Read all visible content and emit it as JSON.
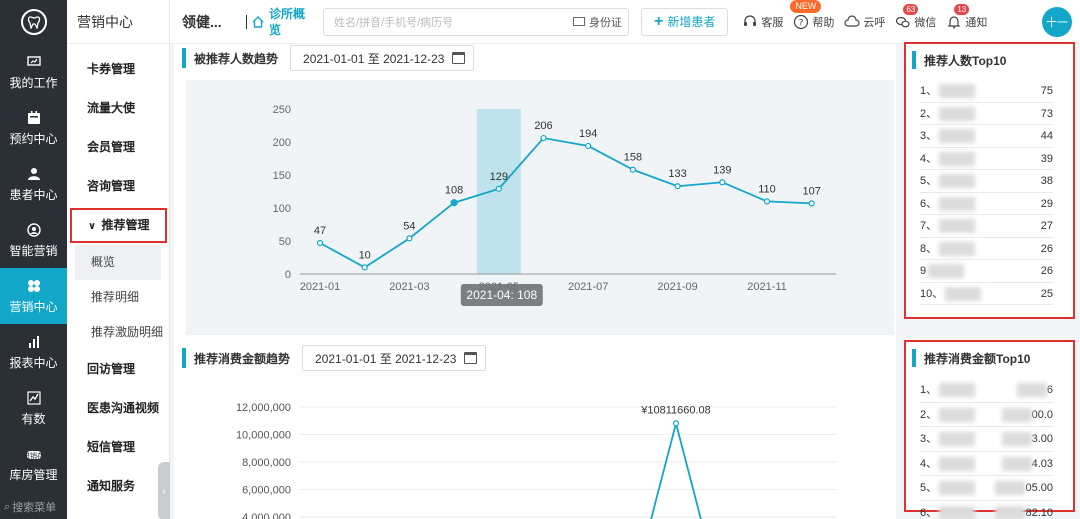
{
  "rail": {
    "items": [
      {
        "label": "我的工作",
        "icon": "monitor-icon"
      },
      {
        "label": "预约中心",
        "icon": "calendar-icon"
      },
      {
        "label": "患者中心",
        "icon": "user-icon"
      },
      {
        "label": "智能营销",
        "icon": "marketing-icon"
      },
      {
        "label": "营销中心",
        "icon": "clover-icon"
      },
      {
        "label": "报表中心",
        "icon": "bar-chart-icon"
      },
      {
        "label": "有数",
        "icon": "line-chart-icon"
      },
      {
        "label": "库房管理",
        "icon": "warehouse-icon",
        "sub": "进销存"
      }
    ],
    "search_label": "搜索菜单"
  },
  "sidebar": {
    "title": "营销中心",
    "items": [
      "卡券管理",
      "流量大使",
      "会员管理",
      "咨询管理",
      "推荐管理"
    ],
    "sub_items": [
      "概览",
      "推荐明细",
      "推荐激励明细"
    ],
    "items_after": [
      "回访管理",
      "医患沟通视频",
      "短信管理",
      "通知服务"
    ]
  },
  "topbar": {
    "clinic": "领健...",
    "home_tab": "诊所概览",
    "search_placeholder": "姓名/拼音/手机号/病历号",
    "id_card": "身份证",
    "new_patient": "新增患者",
    "tools": [
      {
        "label": "客服",
        "icon": "headset-icon"
      },
      {
        "label": "帮助",
        "icon": "help-icon",
        "badge": "NEW"
      },
      {
        "label": "云呼",
        "icon": "cloud-call-icon"
      },
      {
        "label": "微信",
        "icon": "wechat-icon",
        "badge": "63"
      },
      {
        "label": "通知",
        "icon": "bell-icon",
        "badge": "13"
      }
    ],
    "avatar": "十一"
  },
  "trend1": {
    "title": "被推荐人数趋势",
    "date_range": "2021-01-01 至 2021-12-23"
  },
  "trend2": {
    "title": "推荐消费金额趋势",
    "date_range": "2021-01-01 至 2021-12-23"
  },
  "top10_count": {
    "title": "推荐人数Top10",
    "rows": [
      {
        "rank": "1、",
        "value": "75"
      },
      {
        "rank": "2、",
        "value": "73"
      },
      {
        "rank": "3、",
        "value": "44"
      },
      {
        "rank": "4、",
        "value": "39"
      },
      {
        "rank": "5、",
        "value": "38"
      },
      {
        "rank": "6、",
        "value": "29"
      },
      {
        "rank": "7、",
        "value": "27"
      },
      {
        "rank": "8、",
        "value": "26"
      },
      {
        "rank": "9",
        "value": "26"
      },
      {
        "rank": "10、",
        "value": "25"
      }
    ]
  },
  "top10_amount": {
    "title": "推荐消费金额Top10",
    "rows": [
      {
        "rank": "1、",
        "value": "6"
      },
      {
        "rank": "2、",
        "value": "00.0"
      },
      {
        "rank": "3、",
        "value": "3.00"
      },
      {
        "rank": "4、",
        "value": "4.03"
      },
      {
        "rank": "5、",
        "value": "05.00"
      },
      {
        "rank": "6、",
        "value": "82.10"
      }
    ]
  },
  "chart_data": [
    {
      "type": "line",
      "x": [
        "2021-01",
        "2021-02",
        "2021-03",
        "2021-04",
        "2021-05",
        "2021-06",
        "2021-07",
        "2021-08",
        "2021-09",
        "2021-10",
        "2021-11",
        "2021-12"
      ],
      "x_tick_labels": [
        "2021-01",
        "2021-03",
        "2021-05",
        "2021-07",
        "2021-09",
        "2021-11"
      ],
      "values": [
        47,
        10,
        54,
        108,
        129,
        206,
        194,
        158,
        133,
        139,
        110,
        107
      ],
      "ylim": [
        0,
        250
      ],
      "y_ticks": [
        "0",
        "50",
        "100",
        "150",
        "200",
        "250"
      ],
      "highlight": "2021-05",
      "tooltip": "2021-04: 108",
      "color": "#12a7c9"
    },
    {
      "type": "line",
      "y_ticks": [
        "4,000,000",
        "6,000,000",
        "8,000,000",
        "10,000,000",
        "12,000,000"
      ],
      "peak_label": "¥10811660.08",
      "peak_value": 10811660.08,
      "color": "#12a7c9"
    }
  ]
}
